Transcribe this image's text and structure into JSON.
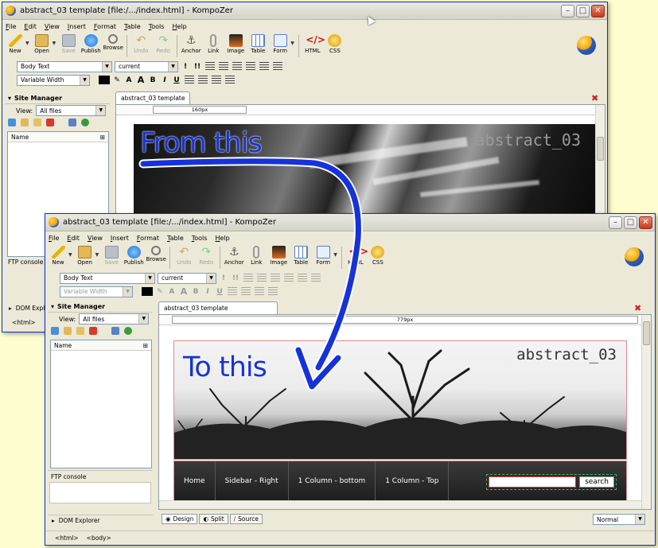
{
  "window_back": {
    "title": "abstract_03 template [file:/.../index.html] - KompoZer",
    "tab": "abstract_03 template",
    "ruler": "160px",
    "banner_title": "abstract_03",
    "ftp": "FTP console",
    "dom": "DOM Explorer",
    "status": [
      "<html>",
      "<"
    ]
  },
  "window_front": {
    "title": "abstract_03 template [file:/.../index.html] - KompoZer",
    "tab": "abstract_03 template",
    "ruler": "779px",
    "banner_title": "abstract_03",
    "nav": [
      "Home",
      "Sidebar - Right",
      "1 Column - bottom",
      "1 Column - Top"
    ],
    "search_button": "search",
    "ftp": "FTP console",
    "dom": "DOM Explorer",
    "bottom_tabs": [
      "Design",
      "Split",
      "Source"
    ],
    "mode": "Normal",
    "status": [
      "<html>",
      "<body>"
    ]
  },
  "menu": [
    "File",
    "Edit",
    "View",
    "Insert",
    "Format",
    "Table",
    "Tools",
    "Help"
  ],
  "toolbar": [
    "New",
    "Open",
    "Save",
    "Publish",
    "Browse",
    "Undo",
    "Redo",
    "Anchor",
    "Link",
    "Image",
    "Table",
    "Form",
    "HTML",
    "CSS"
  ],
  "format": {
    "para_style": "Body Text",
    "class": "current",
    "width": "Variable Width",
    "buttons": [
      "B",
      "I",
      "U"
    ]
  },
  "site_manager": {
    "title": "Site Manager",
    "view_label": "View:",
    "view_value": "All files",
    "name_col": "Name"
  },
  "annotations": {
    "top": "From this",
    "bottom": "To this"
  },
  "colors": {
    "annotation": "#1632d9",
    "background": "#fefdd0",
    "window_frame": "#0831d9"
  }
}
